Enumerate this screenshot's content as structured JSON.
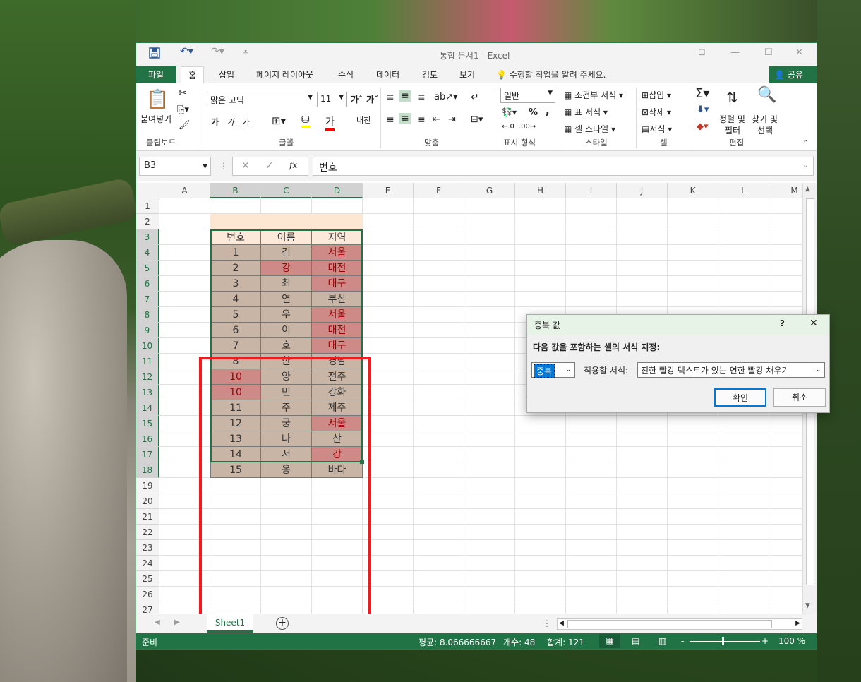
{
  "window": {
    "title": "통합 문서1 - Excel"
  },
  "quick_access": {
    "save": "save-icon",
    "undo": "undo-icon",
    "redo": "redo-icon"
  },
  "tabs": [
    "파일",
    "홈",
    "삽입",
    "페이지 레이아웃",
    "수식",
    "데이터",
    "검토",
    "보기"
  ],
  "tell_me": "수행할 작업을 알려 주세요.",
  "share": "공유",
  "ribbon": {
    "clipboard": {
      "paste": "붙여넣기",
      "label": "클립보드"
    },
    "font": {
      "name": "맑은 고딕",
      "size": "11",
      "bold": "가",
      "italic": "가",
      "underline": "가",
      "label": "글꼴"
    },
    "align": {
      "label": "맞춤"
    },
    "number": {
      "format": "일반",
      "percent": "%",
      "comma": ",",
      "label": "표시 형식"
    },
    "styles": {
      "conditional": "조건부 서식",
      "table": "표 서식",
      "cell_style": "셀 스타일",
      "label": "스타일"
    },
    "cells": {
      "insert": "삽입",
      "delete": "삭제",
      "format": "서식",
      "label": "셀"
    },
    "editing": {
      "sort": "정렬 및",
      "filter": "필터",
      "find": "찾기 및",
      "select": "선택",
      "label": "편집"
    }
  },
  "formula_bar": {
    "name_box": "B3",
    "fx": "fx",
    "value": "번호"
  },
  "columns": [
    "A",
    "B",
    "C",
    "D",
    "E",
    "F",
    "G",
    "H",
    "I",
    "J",
    "K",
    "L",
    "M"
  ],
  "rows": [
    "1",
    "2",
    "3",
    "4",
    "5",
    "6",
    "7",
    "8",
    "9",
    "10",
    "11",
    "12",
    "13",
    "14",
    "15",
    "16",
    "17",
    "18",
    "19",
    "20",
    "21",
    "22",
    "23",
    "24",
    "25",
    "26",
    "27"
  ],
  "table": {
    "headers": [
      "번호",
      "이름",
      "지역"
    ],
    "rows": [
      [
        "1",
        "김",
        "서울"
      ],
      [
        "2",
        "강",
        "대전"
      ],
      [
        "3",
        "최",
        "대구"
      ],
      [
        "4",
        "연",
        "부산"
      ],
      [
        "5",
        "우",
        "서울"
      ],
      [
        "6",
        "이",
        "대전"
      ],
      [
        "7",
        "호",
        "대구"
      ],
      [
        "8",
        "한",
        "경남"
      ],
      [
        "10",
        "양",
        "전주"
      ],
      [
        "10",
        "민",
        "강화"
      ],
      [
        "11",
        "주",
        "제주"
      ],
      [
        "12",
        "궁",
        "서울"
      ],
      [
        "13",
        "나",
        "산"
      ],
      [
        "14",
        "서",
        "강"
      ],
      [
        "15",
        "옹",
        "바다"
      ]
    ],
    "duplicates": [
      [
        0,
        2
      ],
      [
        1,
        1
      ],
      [
        1,
        2
      ],
      [
        2,
        2
      ],
      [
        4,
        2
      ],
      [
        5,
        2
      ],
      [
        6,
        2
      ],
      [
        8,
        0
      ],
      [
        9,
        0
      ],
      [
        11,
        2
      ],
      [
        13,
        2
      ]
    ],
    "colors": {
      "normal": "#c8b5a6",
      "header": "#fde9d9",
      "duplicate": "#cd8a86",
      "highlight": "#fde7d2"
    }
  },
  "sheet": {
    "tab": "Sheet1",
    "add": "+"
  },
  "status": {
    "ready": "준비",
    "average": "평균: 8.066666667",
    "count": "개수: 48",
    "sum": "합계: 121",
    "zoom": "100 %",
    "minus": "-",
    "plus": "+"
  },
  "dialog": {
    "title": "중복 값",
    "help": "?",
    "close": "✕",
    "instruction": "다음 값을 포함하는 셀의 서식 지정:",
    "type_value": "중복",
    "format_label": "적용할 서식:",
    "format_value": "진한 빨강 텍스트가 있는 연한 빨강 채우기",
    "ok": "확인",
    "cancel": "취소"
  }
}
